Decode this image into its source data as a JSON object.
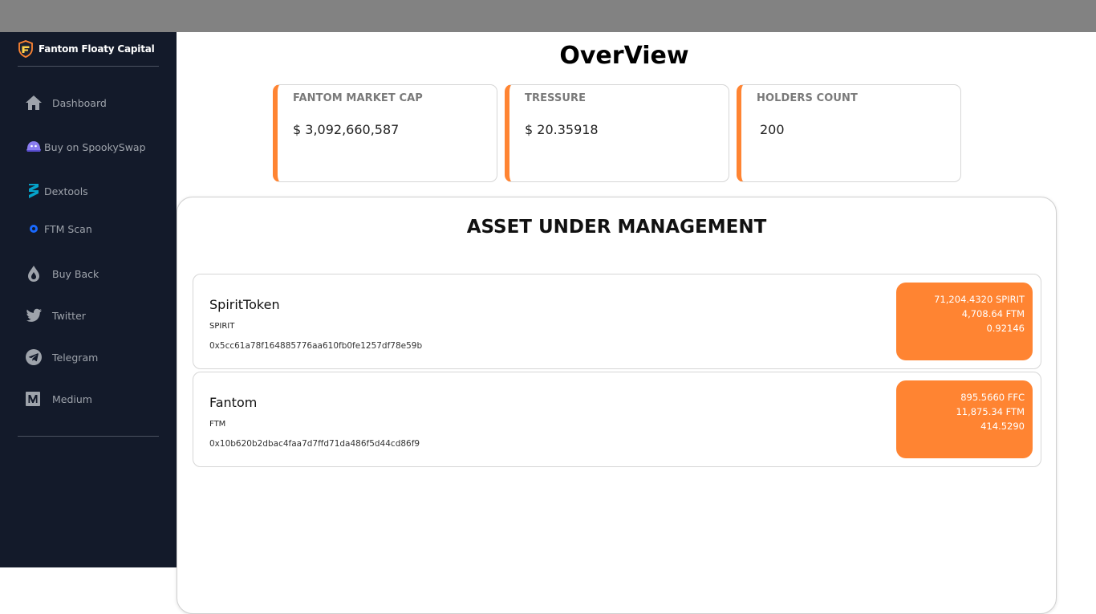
{
  "brand": {
    "name": "Fantom Floaty Capital"
  },
  "sidebar": {
    "items": [
      {
        "label": "Dashboard",
        "icon": "home-icon"
      },
      {
        "label": "Buy on SpookySwap",
        "icon": "spookyswap-ghost-icon"
      },
      {
        "label": "Dextools",
        "icon": "dextools-icon"
      },
      {
        "label": "FTM Scan",
        "icon": "ftmscan-icon"
      },
      {
        "label": "Buy Back",
        "icon": "drop-icon"
      },
      {
        "label": "Twitter",
        "icon": "twitter-icon"
      },
      {
        "label": "Telegram",
        "icon": "telegram-icon"
      },
      {
        "label": "Medium",
        "icon": "medium-icon"
      }
    ]
  },
  "overview": {
    "title": "OverView",
    "cards": [
      {
        "label": "FANTOM MARKET CAP",
        "value": "$ 3,092,660,587"
      },
      {
        "label": "TRESSURE",
        "value": "$ 20.35918"
      },
      {
        "label": "HOLDERS COUNT",
        "value": "200"
      }
    ]
  },
  "aum": {
    "title": "ASSET UNDER MANAGEMENT",
    "assets": [
      {
        "name": "SpiritToken",
        "symbol": "SPIRIT",
        "address": "0x5cc61a78f164885776aa610fb0fe1257df78e59b",
        "amount": "71,204.4320 SPIRIT",
        "ftm_value": "4,708.64 FTM",
        "extra": "0.92146"
      },
      {
        "name": "Fantom",
        "symbol": "FTM",
        "address": "0x10b620b2dbac4faa7d7ffd71da486f5d44cd86f9",
        "amount": "895.5660 FFC",
        "ftm_value": "11,875.34 FTM",
        "extra": "414.5290"
      }
    ]
  },
  "colors": {
    "accent": "#ff8432",
    "sidebar_bg": "#131a2a",
    "topbar_bg": "#828282",
    "nav_text": "#9ea3ab"
  }
}
